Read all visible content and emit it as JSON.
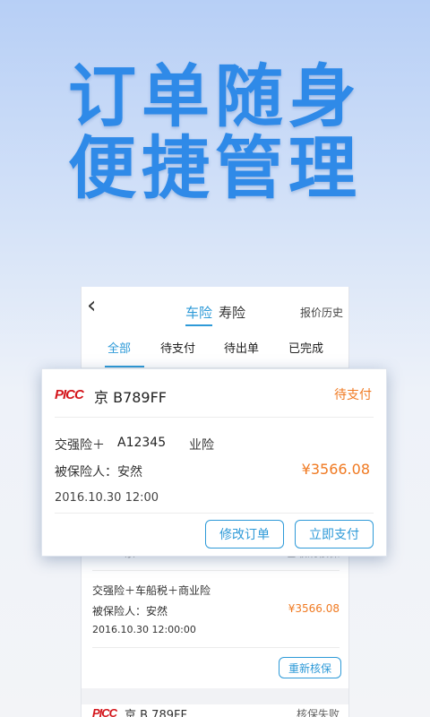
{
  "headline": {
    "line1": "订单随身",
    "line2": "便捷管理"
  },
  "nav": {
    "back_icon": "chevron-left-icon",
    "tabs": [
      {
        "label": "车险",
        "active": true
      },
      {
        "label": "寿险",
        "active": false
      }
    ],
    "right_link": "报价历史"
  },
  "subtabs": [
    {
      "label": "全部",
      "active": true
    },
    {
      "label": "待支付"
    },
    {
      "label": "待出单"
    },
    {
      "label": "已完成"
    }
  ],
  "logo_text": "PICC",
  "featured_order": {
    "plate": "京 B789FF",
    "status": "待支付",
    "insurance_masked": "交强险＋",
    "insurance_overlay": "A12345",
    "insurance_tail": "业险",
    "insured": "被保险人：安然",
    "price": "¥3566.08",
    "date": "2016.10.30 12:00",
    "buttons": {
      "modify": "修改订单",
      "pay": "立即支付"
    }
  },
  "order_2": {
    "plate_partial": "京 B 789FF",
    "status": "已取消核保",
    "insurance": "交强险＋车船税＋商业险",
    "insured": "被保险人：安然",
    "price": "¥3566.08",
    "date": "2016.10.30 12:00:00",
    "button": "重新核保"
  },
  "order_3": {
    "plate": "京 B 789FF",
    "status": "核保失败"
  },
  "colors": {
    "accent": "#2e9ad8",
    "price": "#f07a22",
    "headline": "#2f8ae8",
    "logo": "#d4161c"
  }
}
